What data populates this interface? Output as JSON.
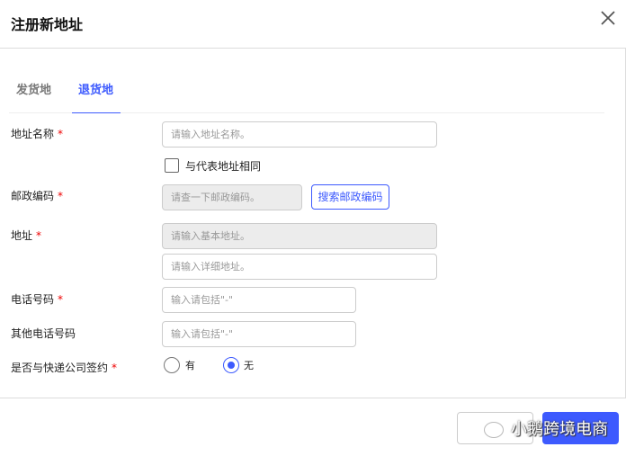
{
  "header": {
    "title": "注册新地址"
  },
  "tabs": [
    {
      "label": "发货地"
    },
    {
      "label": "退货地",
      "active": true
    }
  ],
  "form": {
    "name": {
      "label": "地址名称",
      "required": "*",
      "placeholder": "请输入地址名称。"
    },
    "same": {
      "label": "与代表地址相同",
      "checked": false
    },
    "postal": {
      "label": "邮政编码",
      "required": "*",
      "placeholder": "请查一下邮政编码。",
      "button": "搜索邮政编码"
    },
    "address": {
      "label": "地址",
      "required": "*",
      "placeholder_basic": "请输入基本地址。",
      "placeholder_detail": "请输入详细地址。"
    },
    "phone": {
      "label": "电话号码",
      "required": "*",
      "placeholder": "输入请包括\"-\""
    },
    "other_phone": {
      "label": "其他电话号码",
      "placeholder": "输入请包括\"-\""
    },
    "contract": {
      "label": "是否与快递公司签约",
      "required": "*",
      "options": [
        "有",
        "无"
      ],
      "selected": "无"
    }
  },
  "watermark": "小鹅跨境电商",
  "colors": {
    "accent": "#3d5afe",
    "required": "#e00000"
  }
}
